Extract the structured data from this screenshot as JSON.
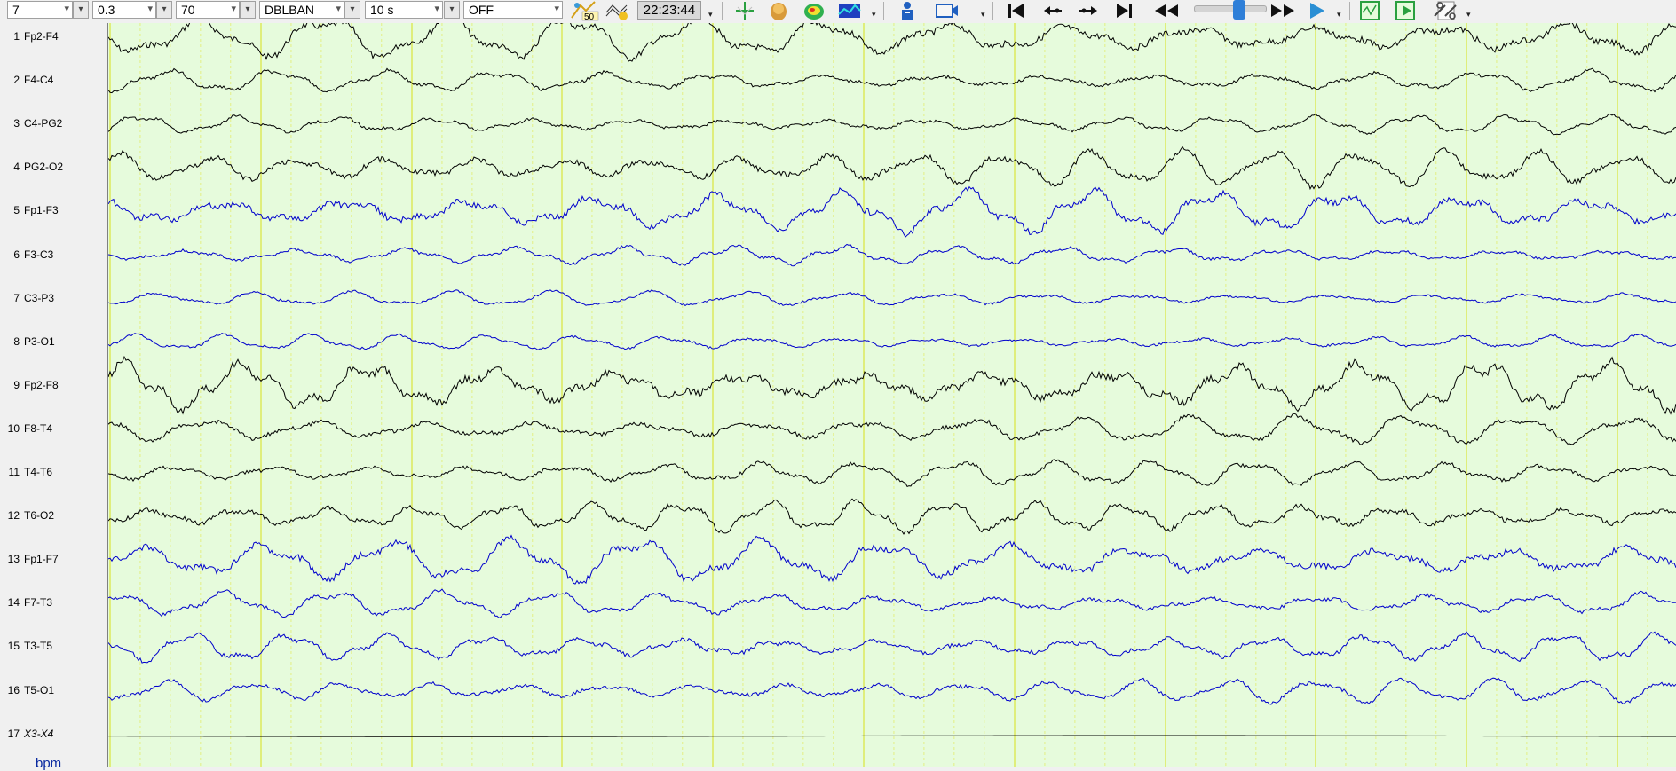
{
  "toolbar": {
    "combos": [
      {
        "name": "montage-count-select",
        "value": "7"
      },
      {
        "name": "low-filter-select",
        "value": "0.3"
      },
      {
        "name": "high-filter-select",
        "value": "70"
      },
      {
        "name": "montage-select",
        "value": "DBLBAN"
      },
      {
        "name": "timebase-select",
        "value": "10 s"
      },
      {
        "name": "notch-select",
        "value": "OFF"
      }
    ],
    "notch_badge": "50",
    "clock": "22:23:44",
    "icons": [
      "filter-50hz-icon",
      "montage-grid-icon",
      "marker-add-icon",
      "head-map-icon",
      "topo-map-icon",
      "spectrum-icon",
      "patient-info-icon",
      "video-icon",
      "go-start-icon",
      "step-back-icon",
      "step-forward-icon",
      "go-end-icon",
      "rewind-icon",
      "fast-forward-icon",
      "play-icon",
      "signal-view-icon",
      "signal-play-icon",
      "settings-icon"
    ],
    "playback_speed": 0.55
  },
  "channels": [
    {
      "num": "1",
      "name": "Fp2-F4",
      "color": "#000000"
    },
    {
      "num": "2",
      "name": "F4-C4",
      "color": "#000000"
    },
    {
      "num": "3",
      "name": "C4-PG2",
      "color": "#000000"
    },
    {
      "num": "4",
      "name": "PG2-O2",
      "color": "#000000"
    },
    {
      "num": "5",
      "name": "Fp1-F3",
      "color": "#0000cc"
    },
    {
      "num": "6",
      "name": "F3-C3",
      "color": "#0000cc"
    },
    {
      "num": "7",
      "name": "C3-P3",
      "color": "#0000cc"
    },
    {
      "num": "8",
      "name": "P3-O1",
      "color": "#0000cc"
    },
    {
      "num": "9",
      "name": "Fp2-F8",
      "color": "#000000"
    },
    {
      "num": "10",
      "name": "F8-T4",
      "color": "#000000"
    },
    {
      "num": "11",
      "name": "T4-T6",
      "color": "#000000"
    },
    {
      "num": "12",
      "name": "T6-O2",
      "color": "#000000"
    },
    {
      "num": "13",
      "name": "Fp1-F7",
      "color": "#0000cc"
    },
    {
      "num": "14",
      "name": "F7-T3",
      "color": "#0000cc"
    },
    {
      "num": "15",
      "name": "T3-T5",
      "color": "#0000cc"
    },
    {
      "num": "16",
      "name": "T5-O1",
      "color": "#0000cc"
    },
    {
      "num": "17",
      "name": "X3-X4",
      "color": "#000000"
    }
  ],
  "bpm_label": "bpm",
  "colors": {
    "trace_bg": "#e6fbdc",
    "grid_major": "#d8e21a",
    "grid_minor": "#e2ea5e"
  }
}
